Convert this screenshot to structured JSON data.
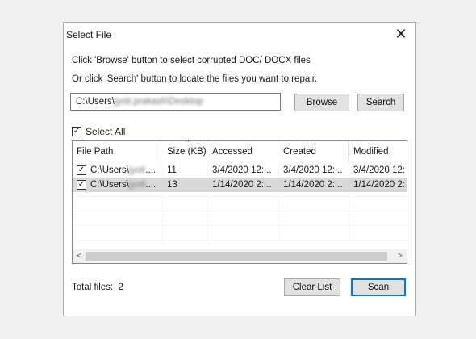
{
  "window": {
    "title": "Select File",
    "close_glyph": "✕"
  },
  "instructions": {
    "line1": "Click 'Browse' button to select corrupted DOC/ DOCX files",
    "line2": "Or click 'Search' button to locate the files you want to repair."
  },
  "path": {
    "value_prefix": "C:\\Users\\",
    "value_blurred": "jyoti.prakash\\Desktop"
  },
  "buttons": {
    "browse": "Browse",
    "search": "Search",
    "clear": "Clear List",
    "scan": "Scan"
  },
  "select_all": {
    "label": "Select All",
    "checked": true,
    "check_glyph": "✓"
  },
  "table": {
    "columns": [
      "File Path",
      "Size (KB)",
      "Accessed",
      "Created",
      "Modified"
    ],
    "sort_glyph": "^",
    "rows": [
      {
        "checked": true,
        "path_prefix": "C:\\Users\\",
        "path_blurred": "jyoti",
        "path_suffix": "....",
        "size": "11",
        "accessed": "3/4/2020 12:...",
        "created": "3/4/2020 12:...",
        "modified": "3/4/2020 12:"
      },
      {
        "checked": true,
        "path_prefix": "C:\\Users\\",
        "path_blurred": "jyoti",
        "path_suffix": "....",
        "size": "13",
        "accessed": "1/14/2020 2:...",
        "created": "1/14/2020 2:...",
        "modified": "1/14/2020 2:"
      }
    ],
    "scroll_left": "<",
    "scroll_right": ">"
  },
  "footer": {
    "total_label": "Total files:",
    "total_count": "2"
  },
  "colors": {
    "accent": "#0078d7",
    "selection": "#d9d9d9"
  }
}
